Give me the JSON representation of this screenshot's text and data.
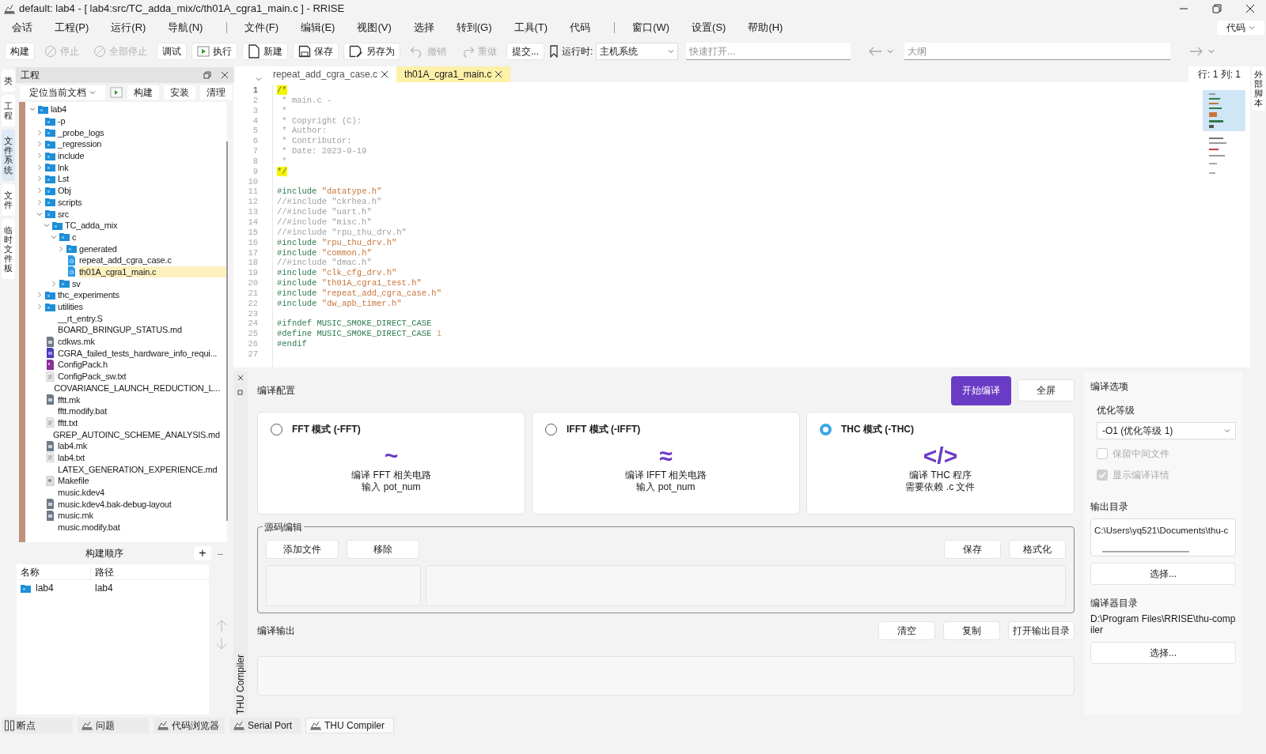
{
  "window": {
    "title": "default:  lab4 - [ lab4:src/TC_adda_mix/c/th01A_cgra1_main.c ] - RRISE"
  },
  "menu": [
    {
      "kind": "item",
      "label": "会话"
    },
    {
      "kind": "item",
      "label": "工程(P)"
    },
    {
      "kind": "item",
      "label": "运行(R)"
    },
    {
      "kind": "item",
      "label": "导航(N)"
    },
    {
      "kind": "separator"
    },
    {
      "kind": "item",
      "label": "文件(F)"
    },
    {
      "kind": "item",
      "label": "编辑(E)"
    },
    {
      "kind": "item",
      "label": "视图(V)"
    },
    {
      "kind": "item",
      "label": "选择"
    },
    {
      "kind": "item",
      "label": "转到(G)"
    },
    {
      "kind": "item",
      "label": "工具(T)"
    },
    {
      "kind": "item",
      "label": "代码"
    },
    {
      "kind": "separator"
    },
    {
      "kind": "item",
      "label": "窗口(W)"
    },
    {
      "kind": "item",
      "label": "设置(S)"
    },
    {
      "kind": "item",
      "label": "帮助(H)"
    }
  ],
  "mode_dropdown": {
    "value": "代码"
  },
  "toolbar": [
    {
      "kind": "plain",
      "label": "构建",
      "disabled": false
    },
    {
      "kind": "stop",
      "label": "停止",
      "disabled": true
    },
    {
      "kind": "stop",
      "label": "全部停止",
      "disabled": true
    },
    {
      "kind": "plain",
      "label": "调试",
      "disabled": false
    },
    {
      "kind": "run",
      "label": "执行",
      "disabled": false
    },
    {
      "kind": "new",
      "label": "新建",
      "disabled": false
    },
    {
      "kind": "save",
      "label": "保存",
      "disabled": false
    },
    {
      "kind": "saveas",
      "label": "另存为",
      "disabled": false
    },
    {
      "kind": "undo",
      "label": "撤销",
      "disabled": true
    },
    {
      "kind": "redo",
      "label": "重做",
      "disabled": true
    },
    {
      "kind": "plain",
      "label": "提交...",
      "disabled": false
    }
  ],
  "runtime": {
    "label": "运行时:",
    "value": "主机系统"
  },
  "quick_open": {
    "placeholder": "快速打开..."
  },
  "outline": {
    "placeholder": "大纲"
  },
  "left_dock": [
    {
      "label": "类",
      "selected": false
    },
    {
      "label": "工程",
      "selected": false
    },
    {
      "label": "文件系统",
      "selected": true
    },
    {
      "label": "文件",
      "selected": false
    },
    {
      "label": "临时文件板",
      "selected": false
    }
  ],
  "right_dock": [
    {
      "label": "外部脚本",
      "selected": false
    }
  ],
  "project_panel": {
    "title": "工程",
    "buttons": [
      "定位当前文档",
      "构建",
      "安装",
      "清理"
    ],
    "tree": [
      {
        "name": "lab4",
        "kind": "folder",
        "expanded": true,
        "selected": false,
        "children": [
          {
            "name": "-p",
            "kind": "folder",
            "selected": false
          },
          {
            "name": "_probe_logs",
            "kind": "folder",
            "expanded": false,
            "selected": false
          },
          {
            "name": "_regression",
            "kind": "folder",
            "expanded": false,
            "selected": false
          },
          {
            "name": "include",
            "kind": "folder",
            "expanded": false,
            "selected": false
          },
          {
            "name": "lnk",
            "kind": "folder",
            "expanded": false,
            "selected": false
          },
          {
            "name": "Lst",
            "kind": "folder",
            "expanded": false,
            "selected": false
          },
          {
            "name": "Obj",
            "kind": "folder",
            "expanded": false,
            "selected": false
          },
          {
            "name": "scripts",
            "kind": "folder",
            "expanded": false,
            "selected": false
          },
          {
            "name": "src",
            "kind": "folder",
            "expanded": true,
            "selected": false,
            "children": [
              {
                "name": "TC_adda_mix",
                "kind": "folder",
                "expanded": true,
                "selected": false,
                "children": [
                  {
                    "name": "c",
                    "kind": "folder",
                    "expanded": true,
                    "selected": false,
                    "children": [
                      {
                        "name": "generated",
                        "kind": "folder",
                        "expanded": false,
                        "selected": false
                      },
                      {
                        "name": "repeat_add_cgra_case.c",
                        "kind": "source",
                        "selected": false
                      },
                      {
                        "name": "th01A_cgra1_main.c",
                        "kind": "source",
                        "selected": true
                      }
                    ]
                  },
                  {
                    "name": "sv",
                    "kind": "folder",
                    "expanded": false,
                    "selected": false
                  }
                ]
              }
            ]
          },
          {
            "name": "thc_experiments",
            "kind": "folder",
            "expanded": false,
            "selected": false
          },
          {
            "name": "utilities",
            "kind": "folder",
            "expanded": false,
            "selected": false
          },
          {
            "name": "__rt_entry.S",
            "kind": "plain",
            "selected": false
          },
          {
            "name": "BOARD_BRINGUP_STATUS.md",
            "kind": "plain",
            "selected": false
          },
          {
            "name": "cdkws.mk",
            "kind": "doc",
            "selected": false
          },
          {
            "name": "CGRA_failed_tests_hardware_info_requi...",
            "kind": "pdf",
            "selected": false
          },
          {
            "name": "ConfigPack.h",
            "kind": "header",
            "selected": false
          },
          {
            "name": "ConfigPack_sw.txt",
            "kind": "text",
            "selected": false
          },
          {
            "name": "COVARIANCE_LAUNCH_REDUCTION_L...",
            "kind": "plain",
            "selected": false
          },
          {
            "name": "fftt.mk",
            "kind": "doc",
            "selected": false
          },
          {
            "name": "fftt.modify.bat",
            "kind": "plain",
            "selected": false
          },
          {
            "name": "fftt.txt",
            "kind": "text",
            "selected": false
          },
          {
            "name": "GREP_AUTOINC_SCHEME_ANALYSIS.md",
            "kind": "plain",
            "selected": false
          },
          {
            "name": "lab4.mk",
            "kind": "doc",
            "selected": false
          },
          {
            "name": "lab4.txt",
            "kind": "text",
            "selected": false
          },
          {
            "name": "LATEX_GENERATION_EXPERIENCE.md",
            "kind": "plain",
            "selected": false
          },
          {
            "name": "Makefile",
            "kind": "script",
            "selected": false
          },
          {
            "name": "music.kdev4",
            "kind": "plain",
            "selected": false
          },
          {
            "name": "music.kdev4.bak-debug-layout",
            "kind": "doc",
            "selected": false
          },
          {
            "name": "music.mk",
            "kind": "doc",
            "selected": false
          },
          {
            "name": "music.modify.bat",
            "kind": "plain",
            "selected": false
          }
        ]
      }
    ]
  },
  "build_order": {
    "title": "构建顺序",
    "add": "+",
    "remove": "−",
    "columns": [
      "名称",
      "路径"
    ],
    "rows": [
      [
        "lab4",
        "lab4"
      ]
    ]
  },
  "editor": {
    "tabs": [
      {
        "label": "repeat_add_cgra_case.c",
        "selected": false
      },
      {
        "label": "th01A_cgra1_main.c",
        "selected": true
      }
    ],
    "position": "行: 1 列: 1",
    "lines": [
      {
        "number": "1",
        "segments": [
          {
            "kind": "match",
            "text": "/*"
          }
        ]
      },
      {
        "number": "2",
        "segments": [
          {
            "kind": "comment",
            "text": " * main.c -"
          }
        ]
      },
      {
        "number": "3",
        "segments": [
          {
            "kind": "comment",
            "text": " *"
          }
        ]
      },
      {
        "number": "4",
        "segments": [
          {
            "kind": "comment",
            "text": " * Copyright (C):"
          }
        ]
      },
      {
        "number": "5",
        "segments": [
          {
            "kind": "comment",
            "text": " * Author:"
          }
        ]
      },
      {
        "number": "6",
        "segments": [
          {
            "kind": "comment",
            "text": " * Contributor:"
          }
        ]
      },
      {
        "number": "7",
        "segments": [
          {
            "kind": "comment",
            "text": " * Date: 2023-9-19"
          }
        ]
      },
      {
        "number": "8",
        "segments": [
          {
            "kind": "comment",
            "text": " *"
          }
        ]
      },
      {
        "number": "9",
        "segments": [
          {
            "kind": "match",
            "text": "*/"
          }
        ]
      },
      {
        "number": "10"
      },
      {
        "number": "11",
        "segments": [
          {
            "kind": "directive",
            "text": "#include "
          },
          {
            "kind": "string",
            "text": "\"datatype.h\""
          }
        ]
      },
      {
        "number": "12",
        "segments": [
          {
            "kind": "comment",
            "text": "//#include \"ckrhea.h\""
          }
        ]
      },
      {
        "number": "13",
        "segments": [
          {
            "kind": "comment",
            "text": "//#include \"uart.h\""
          }
        ]
      },
      {
        "number": "14",
        "segments": [
          {
            "kind": "comment",
            "text": "//#include \"misc.h\""
          }
        ]
      },
      {
        "number": "15",
        "segments": [
          {
            "kind": "comment",
            "text": "//#include \"rpu_thu_drv.h\""
          }
        ]
      },
      {
        "number": "16",
        "segments": [
          {
            "kind": "directive",
            "text": "#include "
          },
          {
            "kind": "string",
            "text": "\"rpu_thu_drv.h\""
          }
        ]
      },
      {
        "number": "17",
        "segments": [
          {
            "kind": "directive",
            "text": "#include "
          },
          {
            "kind": "string",
            "text": "\"common.h\""
          }
        ]
      },
      {
        "number": "18",
        "segments": [
          {
            "kind": "comment",
            "text": "//#include \"dmac.h\""
          }
        ]
      },
      {
        "number": "19",
        "segments": [
          {
            "kind": "directive",
            "text": "#include "
          },
          {
            "kind": "string",
            "text": "\"clk_cfg_drv.h\""
          }
        ]
      },
      {
        "number": "20",
        "segments": [
          {
            "kind": "directive",
            "text": "#include "
          },
          {
            "kind": "string",
            "text": "\"th01A_cgra1_test.h\""
          }
        ]
      },
      {
        "number": "21",
        "segments": [
          {
            "kind": "directive",
            "text": "#include "
          },
          {
            "kind": "string",
            "text": "\"repeat_add_cgra_case.h\""
          }
        ]
      },
      {
        "number": "22",
        "segments": [
          {
            "kind": "directive",
            "text": "#include "
          },
          {
            "kind": "string",
            "text": "\"dw_apb_timer.h\""
          }
        ]
      },
      {
        "number": "23"
      },
      {
        "number": "24",
        "segments": [
          {
            "kind": "directive",
            "text": "#ifndef MUSIC_SMOKE_DIRECT_CASE"
          }
        ]
      },
      {
        "number": "25",
        "segments": [
          {
            "kind": "directive",
            "text": "#define MUSIC_SMOKE_DIRECT_CASE "
          },
          {
            "kind": "number",
            "text": "1"
          }
        ]
      },
      {
        "number": "26",
        "segments": [
          {
            "kind": "directive",
            "text": "#endif"
          }
        ]
      },
      {
        "number": "27"
      }
    ]
  },
  "compiler": {
    "dock_label": "THU Compiler",
    "config_title": "编译配置",
    "start_button": "开始编译",
    "fullscreen_button": "全屏",
    "modes": [
      {
        "title": "FFT 模式 (-FFT)",
        "symbol": "~",
        "description": [
          "编译 FFT 相关电路",
          "输入 pot_num"
        ],
        "selected": false
      },
      {
        "title": "IFFT 模式 (-IFFT)",
        "symbol": "≈",
        "description": [
          "编译 IFFT 相关电路",
          "输入 pot_num"
        ],
        "selected": false
      },
      {
        "title": "THC 模式 (-THC)",
        "symbol": "</>",
        "description": [
          "编译 THC 程序",
          "需要依赖 .c 文件"
        ],
        "selected": true
      }
    ],
    "source_group": {
      "title": "源码编辑",
      "left_buttons": [
        "添加文件",
        "移除"
      ],
      "right_buttons": [
        "保存",
        "格式化"
      ]
    },
    "output": {
      "title": "编译输出",
      "buttons": [
        "清空",
        "复制",
        "打开输出目录"
      ]
    },
    "options": {
      "title": "编译选项",
      "opt_label": "优化等级",
      "opt_value": "-O1 (优化等级 1)",
      "checkboxes": [
        {
          "label": "保留中间文件",
          "checked": false,
          "disabled": true
        },
        {
          "label": "显示编译详情",
          "checked": true,
          "disabled": true
        }
      ],
      "output_dir_label": "输出目录",
      "output_dir": "C:\\Users\\yq521\\Documents\\thu-c",
      "choose_1": "选择...",
      "compiler_dir_label": "编译器目录",
      "compiler_dir": "D:\\Program Files\\RRISE\\thu-compiler",
      "choose_2": "选择..."
    }
  },
  "bottom_tabs": [
    {
      "label": "断点",
      "kind": "breakpoint",
      "selected": false
    },
    {
      "label": "问题",
      "kind": "tool",
      "selected": false
    },
    {
      "label": "代码浏览器",
      "kind": "tool",
      "selected": false
    },
    {
      "label": "Serial Port",
      "kind": "tool",
      "selected": false
    },
    {
      "label": "THU Compiler",
      "kind": "tool",
      "selected": true
    }
  ]
}
